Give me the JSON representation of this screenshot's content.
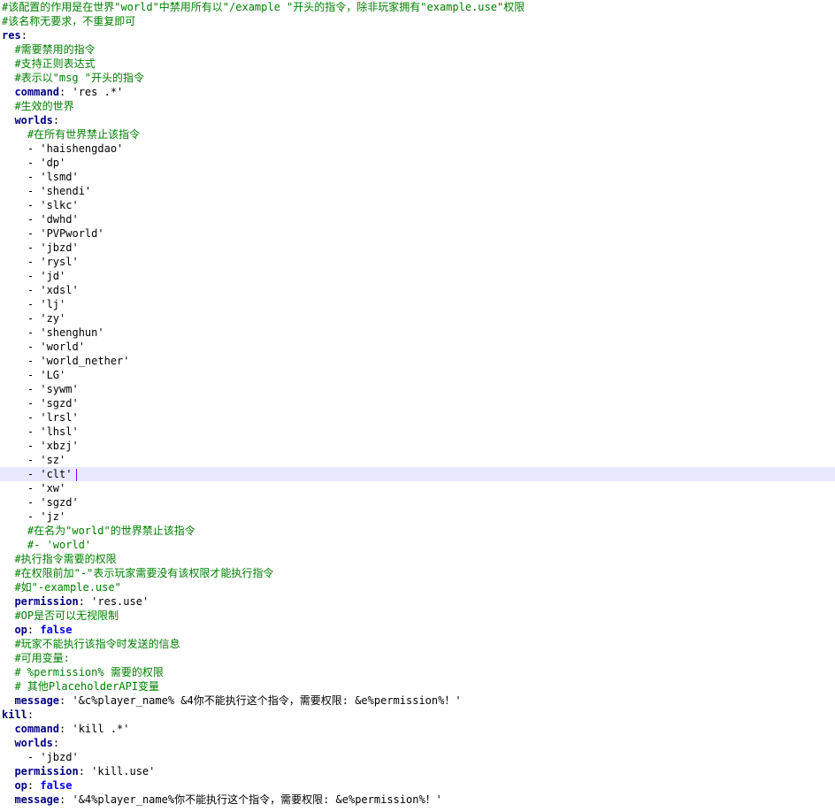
{
  "editor": {
    "current_line": 33,
    "caret_color": "#8000ff",
    "lines": [
      {
        "tokens": [
          {
            "t": "comment",
            "v": "#该配置的作用是在世界\"world\"中禁用所有以\"/example \"开头的指令，除非玩家拥有\"example.use\"权限"
          }
        ]
      },
      {
        "tokens": [
          {
            "t": "comment",
            "v": "#该名称无要求，不重复即可"
          }
        ]
      },
      {
        "tokens": [
          {
            "t": "key",
            "v": "res"
          },
          {
            "t": "plain",
            "v": ":"
          }
        ]
      },
      {
        "tokens": [
          {
            "t": "plain",
            "v": "  "
          },
          {
            "t": "comment",
            "v": "#需要禁用的指令"
          }
        ]
      },
      {
        "tokens": [
          {
            "t": "plain",
            "v": "  "
          },
          {
            "t": "comment",
            "v": "#支持正则表达式"
          }
        ]
      },
      {
        "tokens": [
          {
            "t": "plain",
            "v": "  "
          },
          {
            "t": "comment",
            "v": "#表示以\"msg \"开头的指令"
          }
        ]
      },
      {
        "tokens": [
          {
            "t": "plain",
            "v": "  "
          },
          {
            "t": "key",
            "v": "command"
          },
          {
            "t": "plain",
            "v": ": "
          },
          {
            "t": "str",
            "v": "'res .*'"
          }
        ]
      },
      {
        "tokens": [
          {
            "t": "plain",
            "v": "  "
          },
          {
            "t": "comment",
            "v": "#生效的世界"
          }
        ]
      },
      {
        "tokens": [
          {
            "t": "plain",
            "v": "  "
          },
          {
            "t": "key",
            "v": "worlds"
          },
          {
            "t": "plain",
            "v": ":"
          }
        ]
      },
      {
        "tokens": [
          {
            "t": "plain",
            "v": "    "
          },
          {
            "t": "comment",
            "v": "#在所有世界禁止该指令"
          }
        ]
      },
      {
        "tokens": [
          {
            "t": "plain",
            "v": "    - "
          },
          {
            "t": "str",
            "v": "'haishengdao'"
          }
        ]
      },
      {
        "tokens": [
          {
            "t": "plain",
            "v": "    - "
          },
          {
            "t": "str",
            "v": "'dp'"
          }
        ]
      },
      {
        "tokens": [
          {
            "t": "plain",
            "v": "    - "
          },
          {
            "t": "str",
            "v": "'lsmd'"
          }
        ]
      },
      {
        "tokens": [
          {
            "t": "plain",
            "v": "    - "
          },
          {
            "t": "str",
            "v": "'shendi'"
          }
        ]
      },
      {
        "tokens": [
          {
            "t": "plain",
            "v": "    - "
          },
          {
            "t": "str",
            "v": "'slkc'"
          }
        ]
      },
      {
        "tokens": [
          {
            "t": "plain",
            "v": "    - "
          },
          {
            "t": "str",
            "v": "'dwhd'"
          }
        ]
      },
      {
        "tokens": [
          {
            "t": "plain",
            "v": "    - "
          },
          {
            "t": "str",
            "v": "'PVPworld'"
          }
        ]
      },
      {
        "tokens": [
          {
            "t": "plain",
            "v": "    - "
          },
          {
            "t": "str",
            "v": "'jbzd'"
          }
        ]
      },
      {
        "tokens": [
          {
            "t": "plain",
            "v": "    - "
          },
          {
            "t": "str",
            "v": "'rysl'"
          }
        ]
      },
      {
        "tokens": [
          {
            "t": "plain",
            "v": "    - "
          },
          {
            "t": "str",
            "v": "'jd'"
          }
        ]
      },
      {
        "tokens": [
          {
            "t": "plain",
            "v": "    - "
          },
          {
            "t": "str",
            "v": "'xdsl'"
          }
        ]
      },
      {
        "tokens": [
          {
            "t": "plain",
            "v": "    - "
          },
          {
            "t": "str",
            "v": "'lj'"
          }
        ]
      },
      {
        "tokens": [
          {
            "t": "plain",
            "v": "    - "
          },
          {
            "t": "str",
            "v": "'zy'"
          }
        ]
      },
      {
        "tokens": [
          {
            "t": "plain",
            "v": "    - "
          },
          {
            "t": "str",
            "v": "'shenghun'"
          }
        ]
      },
      {
        "tokens": [
          {
            "t": "plain",
            "v": "    - "
          },
          {
            "t": "str",
            "v": "'world'"
          }
        ]
      },
      {
        "tokens": [
          {
            "t": "plain",
            "v": "    - "
          },
          {
            "t": "str",
            "v": "'world_nether'"
          }
        ]
      },
      {
        "tokens": [
          {
            "t": "plain",
            "v": "    - "
          },
          {
            "t": "str",
            "v": "'LG'"
          }
        ]
      },
      {
        "tokens": [
          {
            "t": "plain",
            "v": "    - "
          },
          {
            "t": "str",
            "v": "'sywm'"
          }
        ]
      },
      {
        "tokens": [
          {
            "t": "plain",
            "v": "    - "
          },
          {
            "t": "str",
            "v": "'sgzd'"
          }
        ]
      },
      {
        "tokens": [
          {
            "t": "plain",
            "v": "    - "
          },
          {
            "t": "str",
            "v": "'lrsl'"
          }
        ]
      },
      {
        "tokens": [
          {
            "t": "plain",
            "v": "    - "
          },
          {
            "t": "str",
            "v": "'lhsl'"
          }
        ]
      },
      {
        "tokens": [
          {
            "t": "plain",
            "v": "    - "
          },
          {
            "t": "str",
            "v": "'xbzj'"
          }
        ]
      },
      {
        "tokens": [
          {
            "t": "plain",
            "v": "    - "
          },
          {
            "t": "str",
            "v": "'sz'"
          }
        ]
      },
      {
        "tokens": [
          {
            "t": "plain",
            "v": "    - "
          },
          {
            "t": "str",
            "v": "'clt'"
          }
        ]
      },
      {
        "tokens": [
          {
            "t": "plain",
            "v": "    - "
          },
          {
            "t": "str",
            "v": "'xw'"
          }
        ]
      },
      {
        "tokens": [
          {
            "t": "plain",
            "v": "    - "
          },
          {
            "t": "str",
            "v": "'sgzd'"
          }
        ]
      },
      {
        "tokens": [
          {
            "t": "plain",
            "v": "    - "
          },
          {
            "t": "str",
            "v": "'jz'"
          }
        ]
      },
      {
        "tokens": [
          {
            "t": "plain",
            "v": "    "
          },
          {
            "t": "comment",
            "v": "#在名为\"world\"的世界禁止该指令"
          }
        ]
      },
      {
        "tokens": [
          {
            "t": "plain",
            "v": "    "
          },
          {
            "t": "comment",
            "v": "#- 'world'"
          }
        ]
      },
      {
        "tokens": [
          {
            "t": "plain",
            "v": "  "
          },
          {
            "t": "comment",
            "v": "#执行指令需要的权限"
          }
        ]
      },
      {
        "tokens": [
          {
            "t": "plain",
            "v": "  "
          },
          {
            "t": "comment",
            "v": "#在权限前加\"-\"表示玩家需要没有该权限才能执行指令"
          }
        ]
      },
      {
        "tokens": [
          {
            "t": "plain",
            "v": "  "
          },
          {
            "t": "comment",
            "v": "#如\"-example.use\""
          }
        ]
      },
      {
        "tokens": [
          {
            "t": "plain",
            "v": "  "
          },
          {
            "t": "key",
            "v": "permission"
          },
          {
            "t": "plain",
            "v": ": "
          },
          {
            "t": "str",
            "v": "'res.use'"
          }
        ]
      },
      {
        "tokens": [
          {
            "t": "plain",
            "v": "  "
          },
          {
            "t": "comment",
            "v": "#OP是否可以无视限制"
          }
        ]
      },
      {
        "tokens": [
          {
            "t": "plain",
            "v": "  "
          },
          {
            "t": "key",
            "v": "op"
          },
          {
            "t": "plain",
            "v": ": "
          },
          {
            "t": "kw",
            "v": "false"
          }
        ]
      },
      {
        "tokens": [
          {
            "t": "plain",
            "v": "  "
          },
          {
            "t": "comment",
            "v": "#玩家不能执行该指令时发送的信息"
          }
        ]
      },
      {
        "tokens": [
          {
            "t": "plain",
            "v": "  "
          },
          {
            "t": "comment",
            "v": "#可用变量:"
          }
        ]
      },
      {
        "tokens": [
          {
            "t": "plain",
            "v": "  "
          },
          {
            "t": "comment",
            "v": "# %permission% 需要的权限"
          }
        ]
      },
      {
        "tokens": [
          {
            "t": "plain",
            "v": "  "
          },
          {
            "t": "comment",
            "v": "# 其他PlaceholderAPI变量"
          }
        ]
      },
      {
        "tokens": [
          {
            "t": "plain",
            "v": "  "
          },
          {
            "t": "key",
            "v": "message"
          },
          {
            "t": "plain",
            "v": ": "
          },
          {
            "t": "str",
            "v": "'&c%player_name% &4你不能执行这个指令，需要权限: &e%permission%！'"
          }
        ]
      },
      {
        "tokens": [
          {
            "t": "key",
            "v": "kill"
          },
          {
            "t": "plain",
            "v": ":"
          }
        ]
      },
      {
        "tokens": [
          {
            "t": "plain",
            "v": "  "
          },
          {
            "t": "key",
            "v": "command"
          },
          {
            "t": "plain",
            "v": ": "
          },
          {
            "t": "str",
            "v": "'kill .*'"
          }
        ]
      },
      {
        "tokens": [
          {
            "t": "plain",
            "v": "  "
          },
          {
            "t": "key",
            "v": "worlds"
          },
          {
            "t": "plain",
            "v": ":"
          }
        ]
      },
      {
        "tokens": [
          {
            "t": "plain",
            "v": "    - "
          },
          {
            "t": "str",
            "v": "'jbzd'"
          }
        ]
      },
      {
        "tokens": [
          {
            "t": "plain",
            "v": "  "
          },
          {
            "t": "key",
            "v": "permission"
          },
          {
            "t": "plain",
            "v": ": "
          },
          {
            "t": "str",
            "v": "'kill.use'"
          }
        ]
      },
      {
        "tokens": [
          {
            "t": "plain",
            "v": "  "
          },
          {
            "t": "key",
            "v": "op"
          },
          {
            "t": "plain",
            "v": ": "
          },
          {
            "t": "kw",
            "v": "false"
          }
        ]
      },
      {
        "tokens": [
          {
            "t": "plain",
            "v": "  "
          },
          {
            "t": "key",
            "v": "message"
          },
          {
            "t": "plain",
            "v": ": "
          },
          {
            "t": "str",
            "v": "'&4%player_name%你不能执行这个指令，需要权限: &e%permission%！'"
          }
        ]
      }
    ]
  }
}
